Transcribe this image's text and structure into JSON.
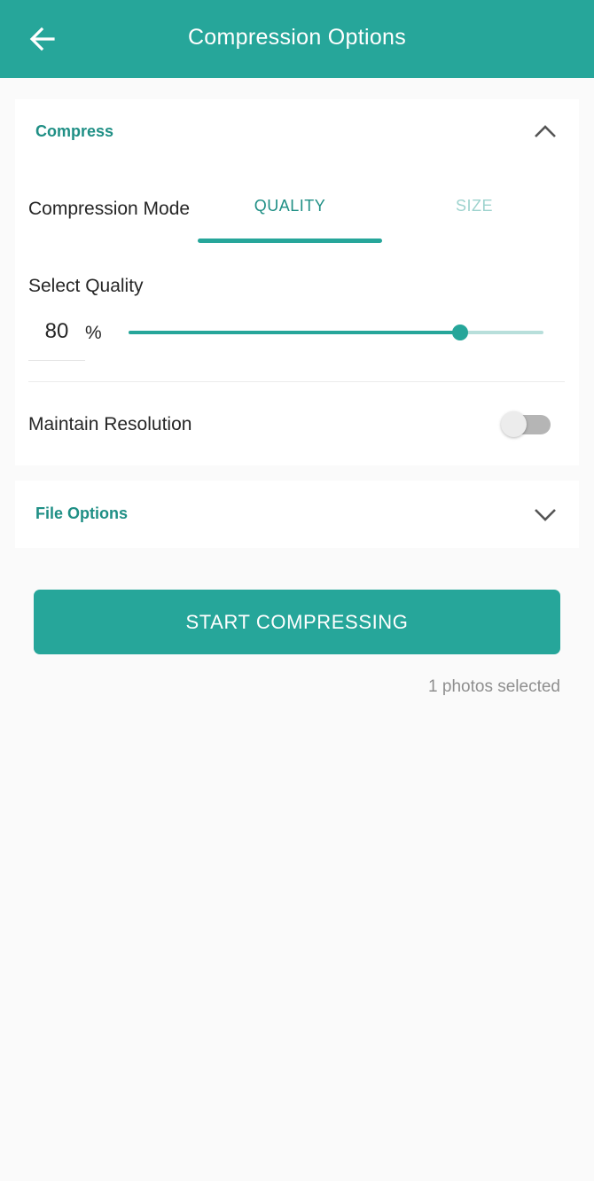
{
  "app_bar": {
    "title": "Compression Options",
    "back_icon": "arrow-left-icon"
  },
  "compress_section": {
    "title": "Compress",
    "expanded": true,
    "chevron_icon": "chevron-up-icon",
    "mode_label": "Compression Mode",
    "tabs": [
      {
        "label": "QUALITY",
        "selected": true
      },
      {
        "label": "SIZE",
        "selected": false
      }
    ],
    "quality_label": "Select Quality",
    "quality_value": "80",
    "quality_unit": "%",
    "quality_slider_fraction": 0.8,
    "maintain_resolution_label": "Maintain Resolution",
    "maintain_resolution_on": false
  },
  "file_options_section": {
    "title": "File Options",
    "expanded": false,
    "chevron_icon": "chevron-down-icon"
  },
  "start_button_label": "START COMPRESSING",
  "selection_status": "1 photos selected",
  "colors": {
    "primary": "#26a69a",
    "section_title": "#1f8f85",
    "tab_inactive": "#9ed3ce",
    "background": "#fafafa"
  }
}
